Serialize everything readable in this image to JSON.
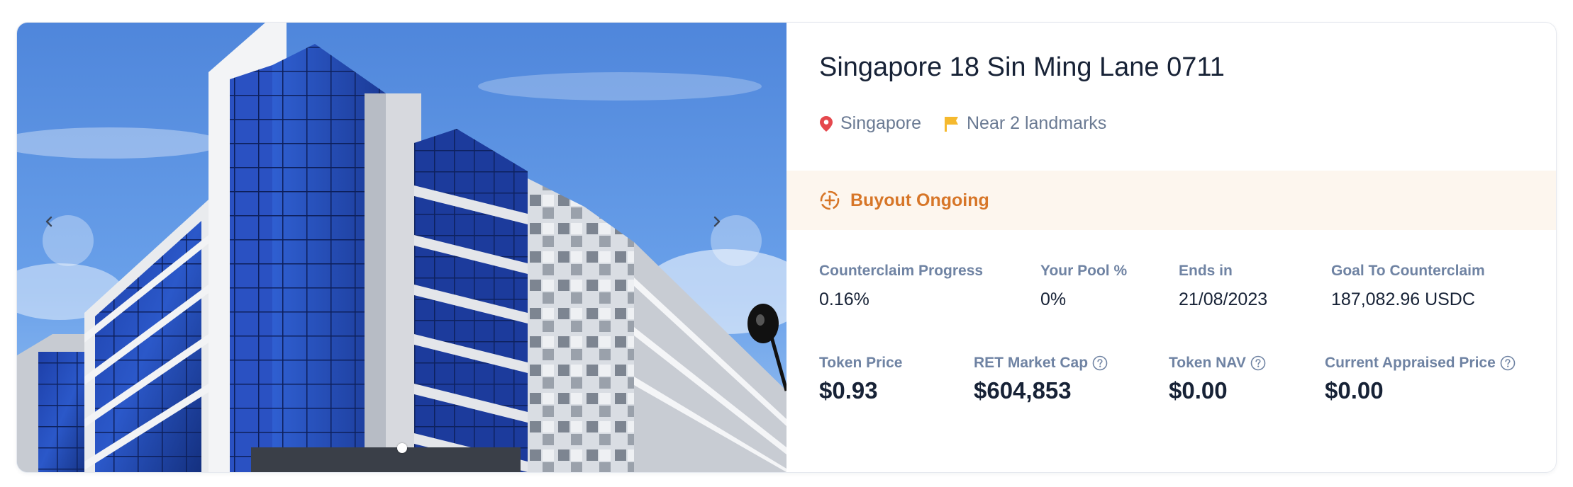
{
  "property": {
    "title": "Singapore 18 Sin Ming Lane 0711",
    "location": "Singapore",
    "landmarks": "Near 2 landmarks"
  },
  "status": {
    "label": "Buyout Ongoing"
  },
  "stats_row1": [
    {
      "label": "Counterclaim Progress",
      "value": "0.16%"
    },
    {
      "label": "Your Pool %",
      "value": "0%"
    },
    {
      "label": "Ends in",
      "value": "21/08/2023"
    },
    {
      "label": "Goal To Counterclaim",
      "value": "187,082.96 USDC"
    }
  ],
  "stats_row2": [
    {
      "label": "Token Price",
      "value": "$0.93"
    },
    {
      "label": "RET Market Cap",
      "value": "$604,853"
    },
    {
      "label": "Token NAV",
      "value": "$0.00"
    },
    {
      "label": "Current Appraised Price",
      "value": "$0.00"
    }
  ],
  "gallery": {
    "slide_count": 1,
    "active_slide": 1
  },
  "colors": {
    "title": "#172236",
    "muted": "#6a7a93",
    "accent_orange": "#d77628",
    "status_bg": "#fdf6ee",
    "pin_red": "#e5484d",
    "flag_yellow": "#f5b92e"
  },
  "icons": {
    "location": "map-pin-icon",
    "landmarks": "flag-icon",
    "status": "buyout-icon",
    "help": "question-circle-icon",
    "prev": "chevron-left-icon",
    "next": "chevron-right-icon"
  }
}
